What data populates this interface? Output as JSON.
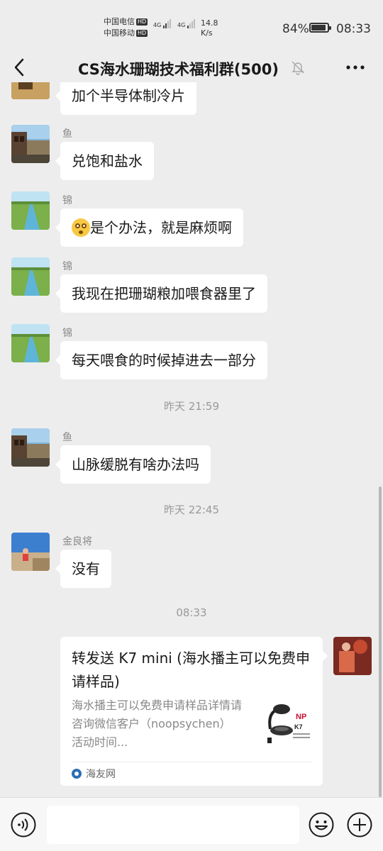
{
  "status_bar": {
    "carrier1": "中国电信",
    "carrier2": "中国移动",
    "hd_badge": "HD",
    "network": "4G",
    "speed_value": "14.8",
    "speed_unit": "K/s",
    "battery_percent": "84%",
    "time": "08:33"
  },
  "header": {
    "title": "CS海水珊瑚技术福利群(500)"
  },
  "messages": [
    {
      "text": "加个半导体制冷片"
    },
    {
      "sender": "鱼",
      "text": "兑饱和盐水"
    },
    {
      "sender": "锦",
      "text": "是个办法，就是麻烦啊",
      "emoji": "flushed-face"
    },
    {
      "sender": "锦",
      "text": "我现在把珊瑚粮加喂食器里了"
    },
    {
      "sender": "锦",
      "text": "每天喂食的时候掉进去一部分"
    },
    {
      "sender": "鱼",
      "text": "山脉缓脱有啥办法吗"
    },
    {
      "sender": "金良将",
      "text": "没有"
    }
  ],
  "timestamps": [
    "昨天 21:59",
    "昨天 22:45",
    "08:33"
  ],
  "link_card": {
    "title": "转发送 K7 mini (海水播主可以免费申请样品)",
    "description": "海水播主可以免费申请样品详情请咨询微信客户（noopsychen）活动时间...",
    "thumb_brand": "NP",
    "thumb_model": "K7",
    "source": "海友网"
  },
  "colors": {
    "background": "#ededed",
    "bubble": "#ffffff",
    "meta_text": "#999999"
  }
}
